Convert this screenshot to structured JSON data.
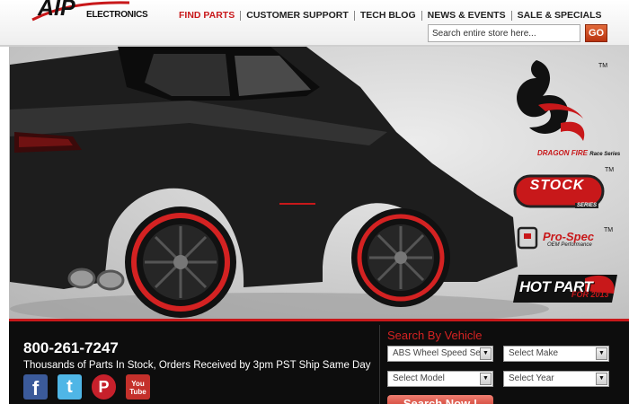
{
  "header": {
    "logo_main": "AIP",
    "logo_sub": "ELECTRONICS",
    "nav": [
      {
        "label": "FIND PARTS",
        "active": true
      },
      {
        "label": "CUSTOMER SUPPORT",
        "active": false
      },
      {
        "label": "TECH BLOG",
        "active": false
      },
      {
        "label": "NEWS & EVENTS",
        "active": false
      },
      {
        "label": "SALE & SPECIALS",
        "active": false
      }
    ],
    "search_value": "Search entire store here...",
    "go_label": "GO"
  },
  "brands": {
    "dragon_fire": {
      "name": "DRAGON FIRE",
      "sub": "Race Series",
      "tm": "TM"
    },
    "stock": {
      "name": "STOCK",
      "sub": "SERIES",
      "tm": "TM"
    },
    "pro_spec": {
      "name": "Pro-Spec",
      "sub": "OEM Performance",
      "tm": "TM"
    },
    "hot_part": {
      "name": "HOT PART",
      "sub": "FOR",
      "year": "2013"
    }
  },
  "footer": {
    "phone": "800-261-7247",
    "tagline": "Thousands of Parts In Stock, Orders Received by 3pm PST Ship Same Day",
    "social": [
      {
        "icon": "facebook-icon",
        "glyph": "f",
        "color": "#3b5a9a"
      },
      {
        "icon": "twitter-icon",
        "glyph": "t",
        "color": "#4fb6e6"
      },
      {
        "icon": "pinterest-icon",
        "glyph": "P",
        "color": "#c6202b"
      },
      {
        "icon": "youtube-icon",
        "glyph": "You Tube",
        "color": "#c4302b"
      }
    ]
  },
  "search_vehicle": {
    "title": "Search By Vehicle",
    "selects": {
      "category": "ABS Wheel Speed Ser",
      "make": "Select Make",
      "model": "Select Model",
      "year": "Select Year"
    },
    "button": "Search Now !"
  },
  "colors": {
    "brand_red": "#c8181a",
    "dark_band": "#0d0d0d"
  }
}
